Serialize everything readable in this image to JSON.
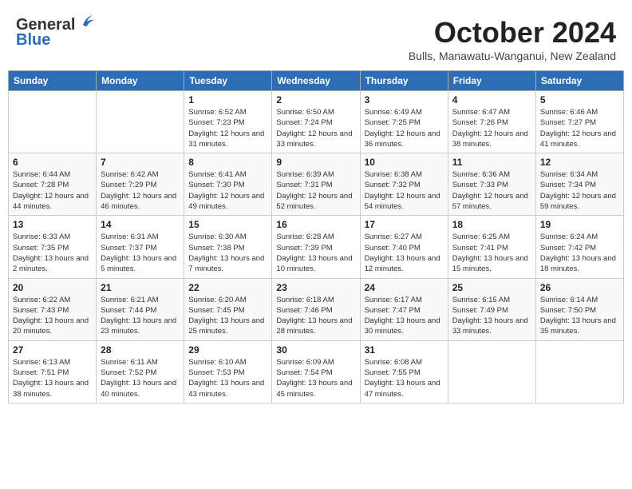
{
  "logo": {
    "general": "General",
    "blue": "Blue"
  },
  "header": {
    "month": "October 2024",
    "location": "Bulls, Manawatu-Wanganui, New Zealand"
  },
  "weekdays": [
    "Sunday",
    "Monday",
    "Tuesday",
    "Wednesday",
    "Thursday",
    "Friday",
    "Saturday"
  ],
  "weeks": [
    [
      null,
      null,
      {
        "day": "1",
        "sunrise": "Sunrise: 6:52 AM",
        "sunset": "Sunset: 7:23 PM",
        "daylight": "Daylight: 12 hours and 31 minutes."
      },
      {
        "day": "2",
        "sunrise": "Sunrise: 6:50 AM",
        "sunset": "Sunset: 7:24 PM",
        "daylight": "Daylight: 12 hours and 33 minutes."
      },
      {
        "day": "3",
        "sunrise": "Sunrise: 6:49 AM",
        "sunset": "Sunset: 7:25 PM",
        "daylight": "Daylight: 12 hours and 36 minutes."
      },
      {
        "day": "4",
        "sunrise": "Sunrise: 6:47 AM",
        "sunset": "Sunset: 7:26 PM",
        "daylight": "Daylight: 12 hours and 38 minutes."
      },
      {
        "day": "5",
        "sunrise": "Sunrise: 6:46 AM",
        "sunset": "Sunset: 7:27 PM",
        "daylight": "Daylight: 12 hours and 41 minutes."
      }
    ],
    [
      {
        "day": "6",
        "sunrise": "Sunrise: 6:44 AM",
        "sunset": "Sunset: 7:28 PM",
        "daylight": "Daylight: 12 hours and 44 minutes."
      },
      {
        "day": "7",
        "sunrise": "Sunrise: 6:42 AM",
        "sunset": "Sunset: 7:29 PM",
        "daylight": "Daylight: 12 hours and 46 minutes."
      },
      {
        "day": "8",
        "sunrise": "Sunrise: 6:41 AM",
        "sunset": "Sunset: 7:30 PM",
        "daylight": "Daylight: 12 hours and 49 minutes."
      },
      {
        "day": "9",
        "sunrise": "Sunrise: 6:39 AM",
        "sunset": "Sunset: 7:31 PM",
        "daylight": "Daylight: 12 hours and 52 minutes."
      },
      {
        "day": "10",
        "sunrise": "Sunrise: 6:38 AM",
        "sunset": "Sunset: 7:32 PM",
        "daylight": "Daylight: 12 hours and 54 minutes."
      },
      {
        "day": "11",
        "sunrise": "Sunrise: 6:36 AM",
        "sunset": "Sunset: 7:33 PM",
        "daylight": "Daylight: 12 hours and 57 minutes."
      },
      {
        "day": "12",
        "sunrise": "Sunrise: 6:34 AM",
        "sunset": "Sunset: 7:34 PM",
        "daylight": "Daylight: 12 hours and 59 minutes."
      }
    ],
    [
      {
        "day": "13",
        "sunrise": "Sunrise: 6:33 AM",
        "sunset": "Sunset: 7:35 PM",
        "daylight": "Daylight: 13 hours and 2 minutes."
      },
      {
        "day": "14",
        "sunrise": "Sunrise: 6:31 AM",
        "sunset": "Sunset: 7:37 PM",
        "daylight": "Daylight: 13 hours and 5 minutes."
      },
      {
        "day": "15",
        "sunrise": "Sunrise: 6:30 AM",
        "sunset": "Sunset: 7:38 PM",
        "daylight": "Daylight: 13 hours and 7 minutes."
      },
      {
        "day": "16",
        "sunrise": "Sunrise: 6:28 AM",
        "sunset": "Sunset: 7:39 PM",
        "daylight": "Daylight: 13 hours and 10 minutes."
      },
      {
        "day": "17",
        "sunrise": "Sunrise: 6:27 AM",
        "sunset": "Sunset: 7:40 PM",
        "daylight": "Daylight: 13 hours and 12 minutes."
      },
      {
        "day": "18",
        "sunrise": "Sunrise: 6:25 AM",
        "sunset": "Sunset: 7:41 PM",
        "daylight": "Daylight: 13 hours and 15 minutes."
      },
      {
        "day": "19",
        "sunrise": "Sunrise: 6:24 AM",
        "sunset": "Sunset: 7:42 PM",
        "daylight": "Daylight: 13 hours and 18 minutes."
      }
    ],
    [
      {
        "day": "20",
        "sunrise": "Sunrise: 6:22 AM",
        "sunset": "Sunset: 7:43 PM",
        "daylight": "Daylight: 13 hours and 20 minutes."
      },
      {
        "day": "21",
        "sunrise": "Sunrise: 6:21 AM",
        "sunset": "Sunset: 7:44 PM",
        "daylight": "Daylight: 13 hours and 23 minutes."
      },
      {
        "day": "22",
        "sunrise": "Sunrise: 6:20 AM",
        "sunset": "Sunset: 7:45 PM",
        "daylight": "Daylight: 13 hours and 25 minutes."
      },
      {
        "day": "23",
        "sunrise": "Sunrise: 6:18 AM",
        "sunset": "Sunset: 7:46 PM",
        "daylight": "Daylight: 13 hours and 28 minutes."
      },
      {
        "day": "24",
        "sunrise": "Sunrise: 6:17 AM",
        "sunset": "Sunset: 7:47 PM",
        "daylight": "Daylight: 13 hours and 30 minutes."
      },
      {
        "day": "25",
        "sunrise": "Sunrise: 6:15 AM",
        "sunset": "Sunset: 7:49 PM",
        "daylight": "Daylight: 13 hours and 33 minutes."
      },
      {
        "day": "26",
        "sunrise": "Sunrise: 6:14 AM",
        "sunset": "Sunset: 7:50 PM",
        "daylight": "Daylight: 13 hours and 35 minutes."
      }
    ],
    [
      {
        "day": "27",
        "sunrise": "Sunrise: 6:13 AM",
        "sunset": "Sunset: 7:51 PM",
        "daylight": "Daylight: 13 hours and 38 minutes."
      },
      {
        "day": "28",
        "sunrise": "Sunrise: 6:11 AM",
        "sunset": "Sunset: 7:52 PM",
        "daylight": "Daylight: 13 hours and 40 minutes."
      },
      {
        "day": "29",
        "sunrise": "Sunrise: 6:10 AM",
        "sunset": "Sunset: 7:53 PM",
        "daylight": "Daylight: 13 hours and 43 minutes."
      },
      {
        "day": "30",
        "sunrise": "Sunrise: 6:09 AM",
        "sunset": "Sunset: 7:54 PM",
        "daylight": "Daylight: 13 hours and 45 minutes."
      },
      {
        "day": "31",
        "sunrise": "Sunrise: 6:08 AM",
        "sunset": "Sunset: 7:55 PM",
        "daylight": "Daylight: 13 hours and 47 minutes."
      },
      null,
      null
    ]
  ]
}
